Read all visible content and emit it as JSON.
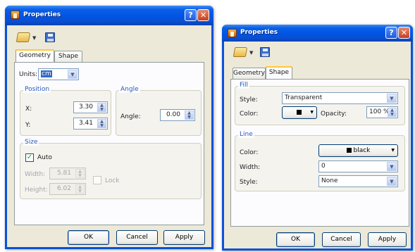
{
  "left": {
    "title": "Properties",
    "tabs": [
      "Geometry",
      "Shape"
    ],
    "units": {
      "label": "Units:",
      "value": "cm"
    },
    "position": {
      "title": "Position",
      "x_label": "X:",
      "x_value": "3.30",
      "y_label": "Y:",
      "y_value": "3.41"
    },
    "angle": {
      "title": "Angle",
      "label": "Angle:",
      "value": "0.00"
    },
    "size": {
      "title": "Size",
      "auto_label": "Auto",
      "auto_checked": true,
      "width_label": "Width:",
      "width_value": "5.81",
      "height_label": "Height:",
      "height_value": "6.02",
      "lock_label": "Lock",
      "lock_checked": false
    },
    "buttons": {
      "ok": "OK",
      "cancel": "Cancel",
      "apply": "Apply"
    }
  },
  "right": {
    "title": "Properties",
    "tabs": [
      "Geometry",
      "Shape"
    ],
    "fill": {
      "title": "Fill",
      "style_label": "Style:",
      "style_value": "Transparent",
      "color_label": "Color:",
      "opacity_label": "Opacity:",
      "opacity_value": "100 %"
    },
    "line": {
      "title": "Line",
      "color_label": "Color:",
      "color_value": "black",
      "width_label": "Width:",
      "width_value": "0",
      "style_label": "Style:",
      "style_value": "None"
    },
    "buttons": {
      "ok": "OK",
      "cancel": "Cancel",
      "apply": "Apply"
    }
  },
  "icons": {
    "open": "folder-icon",
    "save": "floppy-icon",
    "help": "help-icon",
    "close": "close-icon"
  },
  "colors": {
    "titlebar": "#0054e3",
    "window_bg": "#ece9d8",
    "group_title": "#2859bd",
    "fill_color": "#000000",
    "line_color": "#000000"
  }
}
